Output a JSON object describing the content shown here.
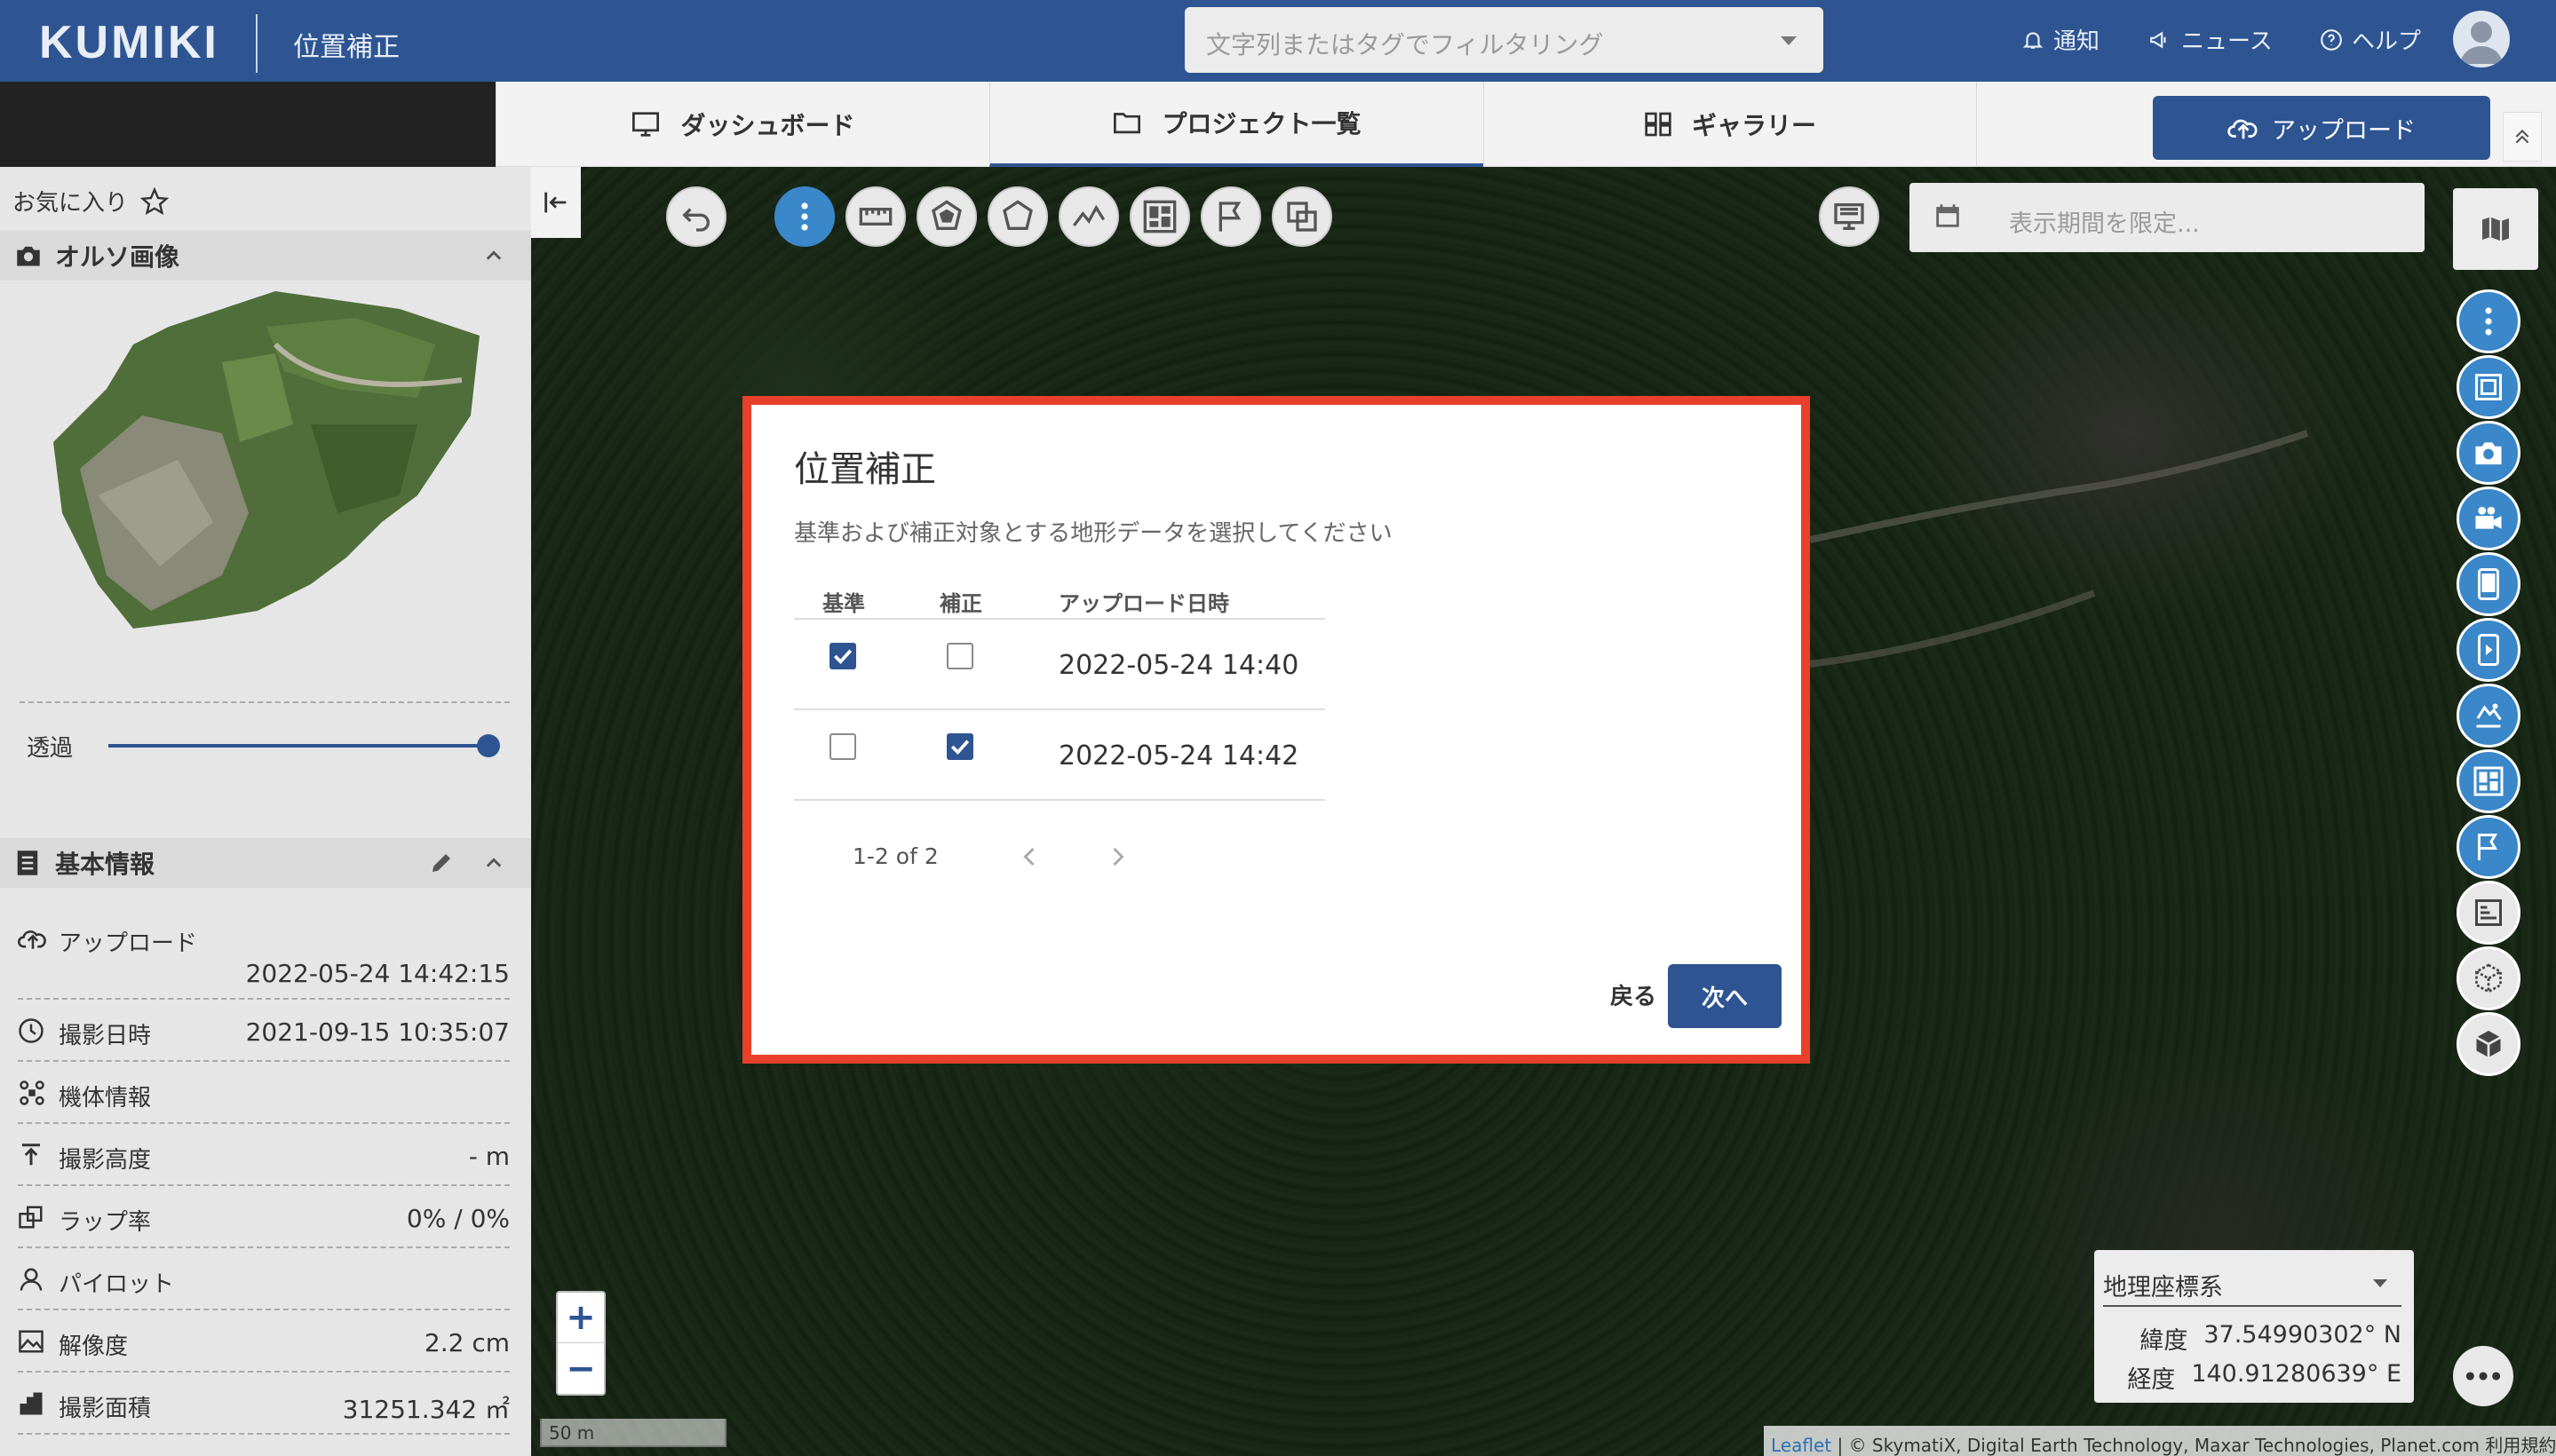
{
  "header": {
    "logo": "KUMIKI",
    "title": "位置補正",
    "filter_placeholder": "文字列またはタグでフィルタリング",
    "nav": [
      {
        "label": "通知",
        "icon": "bell-icon"
      },
      {
        "label": "ニュース",
        "icon": "megaphone-icon"
      },
      {
        "label": "ヘルプ",
        "icon": "help-circle-icon"
      }
    ]
  },
  "tabs": [
    {
      "label": "ダッシュボード",
      "icon": "monitor-icon"
    },
    {
      "label": "プロジェクト一覧",
      "icon": "folder-icon",
      "active": true
    },
    {
      "label": "ギャラリー",
      "icon": "grid-icon"
    }
  ],
  "upload_label": "アップロード",
  "sidebar": {
    "favorites_label": "お気に入り",
    "ortho_title": "オルソ画像",
    "opacity_label": "透過",
    "opacity_value": 1.0,
    "basic_info_title": "基本情報",
    "upload_label": "アップロード",
    "upload_value": "2022-05-24 14:42:15",
    "rows": [
      {
        "label": "撮影日時",
        "value": "2021-09-15 10:35:07",
        "icon": "clock-icon"
      },
      {
        "label": "機体情報",
        "value": "",
        "icon": "drone-icon"
      },
      {
        "label": "撮影高度",
        "value": "- m",
        "icon": "altitude-icon"
      },
      {
        "label": "ラップ率",
        "value": "0% / 0%",
        "icon": "overlap-icon"
      },
      {
        "label": "パイロット",
        "value": "",
        "icon": "person-icon"
      },
      {
        "label": "解像度",
        "value": "2.2 cm",
        "icon": "image-icon"
      },
      {
        "label": "撮影面積",
        "value": "31251.342 ㎡",
        "icon": "area-icon"
      }
    ]
  },
  "map": {
    "date_placeholder": "表示期間を限定...",
    "zoom_in": "+",
    "zoom_out": "−",
    "scale": "50 m",
    "coord_system": "地理座標系",
    "lat_label": "緯度",
    "lat_value": "37.54990302° N",
    "lon_label": "経度",
    "lon_value": "140.91280639° E",
    "attribution_link": "Leaflet",
    "attribution_text": " | © SkymatiX, Digital Earth Technology, Maxar Technologies, Planet.com 利用規約"
  },
  "modal": {
    "title": "位置補正",
    "subtitle": "基準および補正対象とする地形データを選択してください",
    "columns": [
      "基準",
      "補正",
      "アップロード日時"
    ],
    "rows": [
      {
        "base": true,
        "correct": false,
        "datetime": "2022-05-24 14:40"
      },
      {
        "base": false,
        "correct": true,
        "datetime": "2022-05-24 14:42"
      }
    ],
    "pagination": "1-2 of 2",
    "back_label": "戻る",
    "next_label": "次へ"
  },
  "colors": {
    "brand": "#2e5592",
    "accent": "#3a87c9",
    "highlight_border": "#e8402b"
  }
}
